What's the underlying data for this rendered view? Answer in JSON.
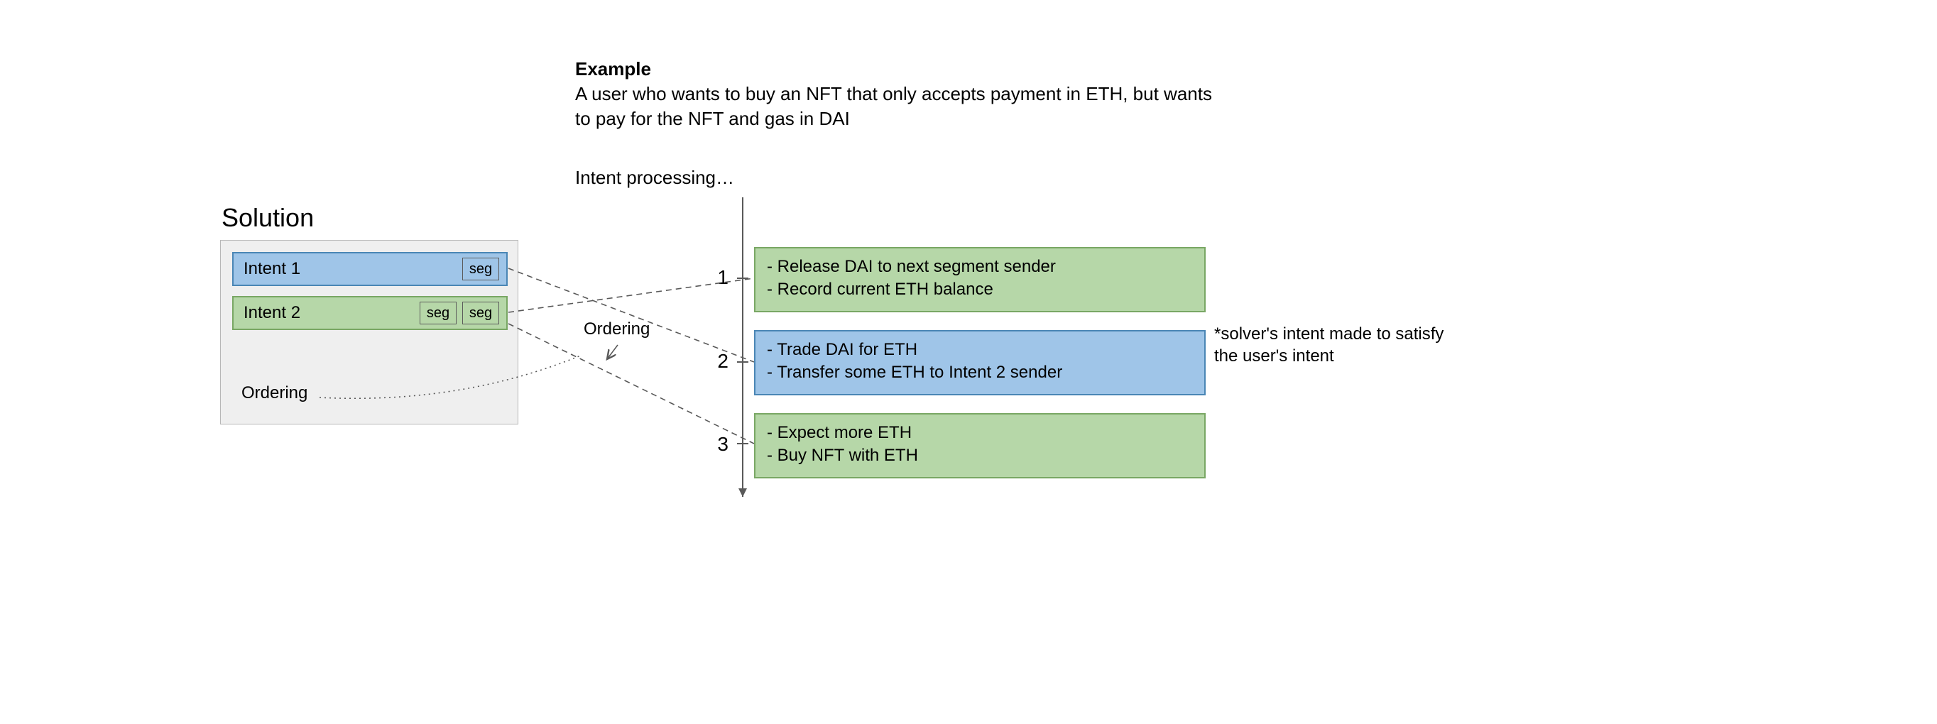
{
  "example": {
    "heading": "Example",
    "description": "A user who wants to buy an NFT that only accepts payment in ETH, but wants to pay for the NFT and gas in DAI"
  },
  "processing_label": "Intent processing…",
  "solution": {
    "title": "Solution",
    "intent1": {
      "label": "Intent 1",
      "seg1": "seg"
    },
    "intent2": {
      "label": "Intent 2",
      "seg1": "seg",
      "seg2": "seg"
    },
    "ordering_label": "Ordering"
  },
  "midline_ordering_label": "Ordering",
  "steps": {
    "s1": {
      "num": "1",
      "l1": "- Release DAI to next segment sender",
      "l2": "- Record current ETH balance"
    },
    "s2": {
      "num": "2",
      "l1": "- Trade DAI for ETH",
      "l2": "- Transfer some ETH to Intent 2 sender"
    },
    "s3": {
      "num": "3",
      "l1": "- Expect more ETH",
      "l2": "- Buy NFT with ETH"
    }
  },
  "annotation": "*solver's intent made to satisfy the user's intent",
  "colors": {
    "blue_fill": "#9fc5e8",
    "blue_border": "#4a86b5",
    "green_fill": "#b6d7a8",
    "green_border": "#79a764",
    "panel_fill": "#efefef",
    "panel_border": "#b7b7b7"
  }
}
